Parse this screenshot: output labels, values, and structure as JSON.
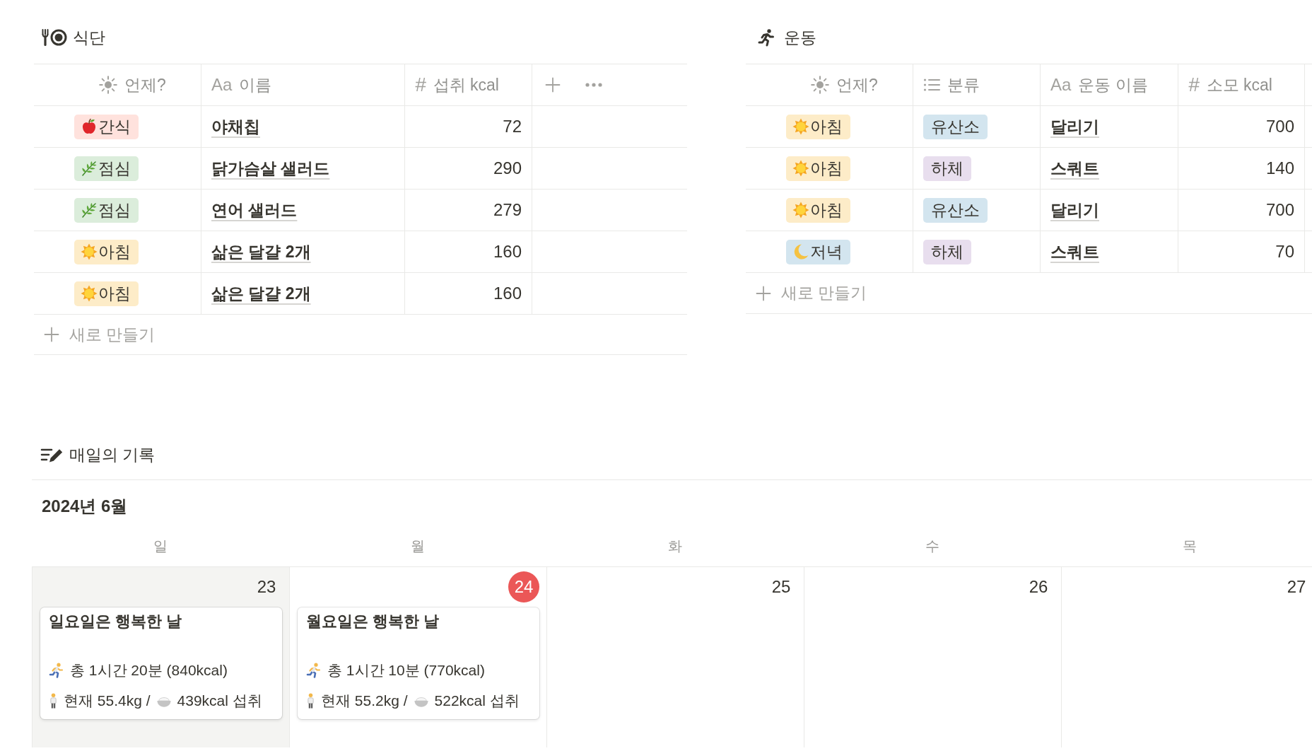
{
  "meals": {
    "title": "식단",
    "columns": [
      {
        "kind": "select",
        "label": "언제?"
      },
      {
        "kind": "title",
        "glyph": "Aa",
        "label": "이름"
      },
      {
        "kind": "number",
        "glyph": "#",
        "label": "섭취 kcal"
      }
    ],
    "rows": [
      {
        "when": {
          "kind": "snack",
          "label": "간식",
          "color": "#ffe2dd"
        },
        "name": "야채칩",
        "kcal": "72"
      },
      {
        "when": {
          "kind": "lunch",
          "label": "점심",
          "color": "#dbeddb"
        },
        "name": "닭가슴살 샐러드",
        "kcal": "290"
      },
      {
        "when": {
          "kind": "lunch",
          "label": "점심",
          "color": "#dbeddb"
        },
        "name": "연어 샐러드",
        "kcal": "279"
      },
      {
        "when": {
          "kind": "breakfast",
          "label": "아침",
          "color": "#fdecc8"
        },
        "name": "삶은 달걀 2개",
        "kcal": "160"
      },
      {
        "when": {
          "kind": "breakfast",
          "label": "아침",
          "color": "#fdecc8"
        },
        "name": "삶은 달걀 2개",
        "kcal": "160"
      }
    ],
    "new_row": "새로 만들기"
  },
  "exercise": {
    "title": "운동",
    "columns": [
      {
        "kind": "select",
        "label": "언제?"
      },
      {
        "kind": "multi_select",
        "label": "분류"
      },
      {
        "kind": "title",
        "glyph": "Aa",
        "label": "운동 이름"
      },
      {
        "kind": "number",
        "glyph": "#",
        "label": "소모 kcal"
      }
    ],
    "rows": [
      {
        "when": {
          "kind": "breakfast",
          "label": "아침",
          "color": "#fdecc8"
        },
        "category": {
          "label": "유산소",
          "color": "#d3e5ef"
        },
        "name": "달리기",
        "kcal": "700"
      },
      {
        "when": {
          "kind": "breakfast",
          "label": "아침",
          "color": "#fdecc8"
        },
        "category": {
          "label": "하체",
          "color": "#e8deee"
        },
        "name": "스쿼트",
        "kcal": "140"
      },
      {
        "when": {
          "kind": "breakfast",
          "label": "아침",
          "color": "#fdecc8"
        },
        "category": {
          "label": "유산소",
          "color": "#d3e5ef"
        },
        "name": "달리기",
        "kcal": "700"
      },
      {
        "when": {
          "kind": "dinner",
          "label": "저녁",
          "color": "#d3e5ef"
        },
        "category": {
          "label": "하체",
          "color": "#e8deee"
        },
        "name": "스쿼트",
        "kcal": "70"
      }
    ],
    "new_row": "새로 만들기"
  },
  "daily_log": {
    "title": "매일의 기록",
    "month": "2024년 6월",
    "days": [
      {
        "weekday": "일",
        "date": "23",
        "weekend": true,
        "today": false,
        "entries": [
          {
            "title": "일요일은 행복한 날",
            "exercise": "총 1시간 20분 (840kcal)",
            "weight": "현재 55.4kg /",
            "intake": "439kcal 섭취"
          }
        ]
      },
      {
        "weekday": "월",
        "date": "24",
        "weekend": false,
        "today": true,
        "entries": [
          {
            "title": "월요일은 행복한 날",
            "exercise": "총 1시간 10분 (770kcal)",
            "weight": "현재 55.2kg /",
            "intake": "522kcal 섭취"
          }
        ]
      },
      {
        "weekday": "화",
        "date": "25",
        "weekend": false,
        "today": false
      },
      {
        "weekday": "수",
        "date": "26",
        "weekend": false,
        "today": false
      },
      {
        "weekday": "목",
        "date": "27",
        "weekend": false,
        "today": false
      }
    ]
  }
}
